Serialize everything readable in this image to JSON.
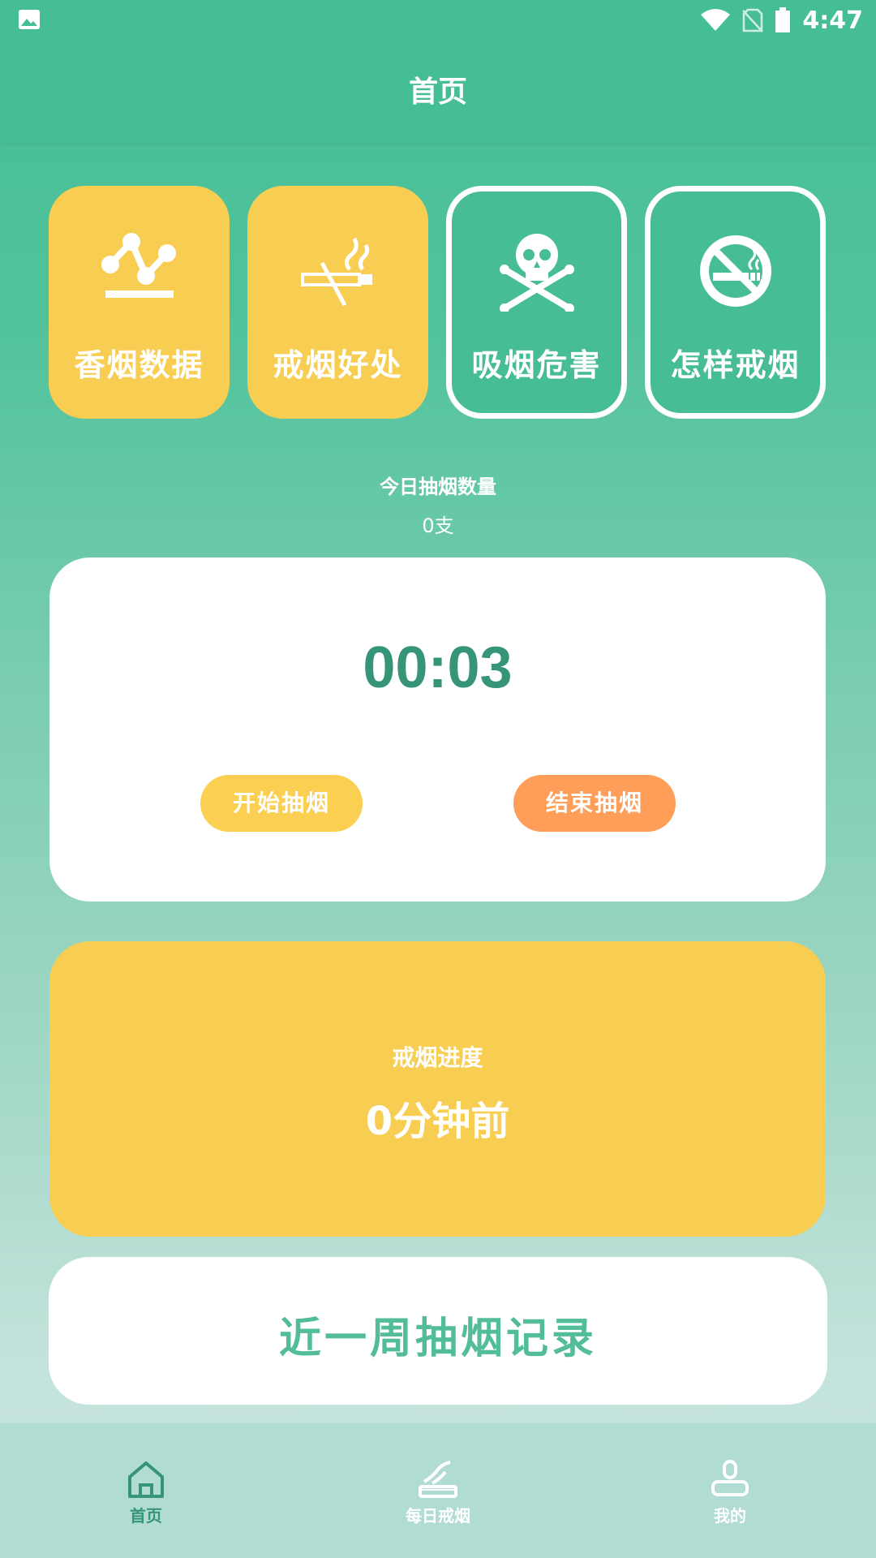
{
  "status_bar": {
    "time": "4:47",
    "left_icon": "image-icon",
    "right_icons": [
      "wifi-icon",
      "no-sim-icon",
      "battery-icon"
    ]
  },
  "app_bar": {
    "title": "首页"
  },
  "tiles": [
    {
      "label": "香烟数据",
      "icon": "chart-icon",
      "style": "filled"
    },
    {
      "label": "戒烟好处",
      "icon": "no-cigarette-icon",
      "style": "filled"
    },
    {
      "label": "吸烟危害",
      "icon": "skull-crossbones-icon",
      "style": "outline"
    },
    {
      "label": "怎样戒烟",
      "icon": "no-smoking-sign-icon",
      "style": "outline"
    }
  ],
  "today": {
    "label": "今日抽烟数量",
    "count": "0支"
  },
  "timer_card": {
    "time": "00:03",
    "start_label": "开始抽烟",
    "end_label": "结束抽烟"
  },
  "progress_card": {
    "label": "戒烟进度",
    "value": "0分钟前"
  },
  "week_card": {
    "title": "近一周抽烟记录"
  },
  "bottom_nav": {
    "items": [
      {
        "label": "首页",
        "icon": "home-icon",
        "active": true
      },
      {
        "label": "每日戒烟",
        "icon": "cigarette-icon",
        "active": false
      },
      {
        "label": "我的",
        "icon": "profile-icon",
        "active": false
      }
    ]
  },
  "colors": {
    "primary": "#45be96",
    "yellow": "#f7cd52",
    "orange": "#fe9e58",
    "dark_green": "#369478",
    "nav_bg": "#b1dcd3"
  }
}
